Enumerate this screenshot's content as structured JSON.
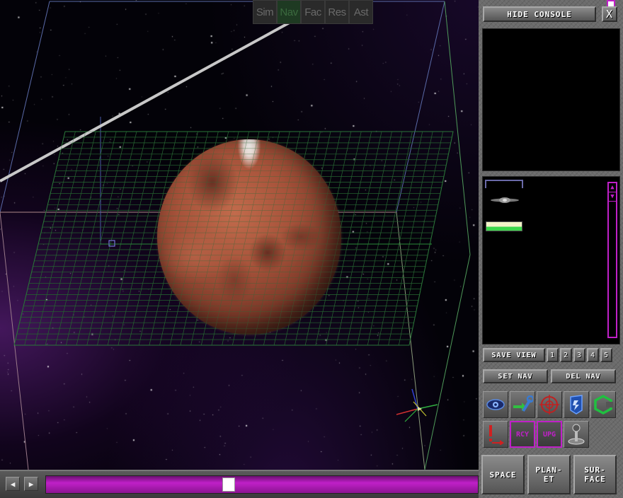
{
  "viewport": {
    "subtabs": [
      {
        "label": "Sim",
        "active": false
      },
      {
        "label": "Nav",
        "active": true
      },
      {
        "label": "Fac",
        "active": false
      },
      {
        "label": "Res",
        "active": false
      },
      {
        "label": "Ast",
        "active": false
      }
    ],
    "planet_icon": "mars-planet"
  },
  "timeline": {
    "left_arrow": "◀",
    "right_arrow": "▶",
    "position": 0.42
  },
  "console": {
    "hide_label": "HIDE CONSOLE",
    "close_label": "X",
    "list": {
      "scroll_up": "▲",
      "scroll_down": "▼",
      "ship_icon": "ship-icon",
      "health_fill": 0.45
    },
    "save_view_label": "SAVE VIEW",
    "view_slots": [
      "1",
      "2",
      "3",
      "4",
      "5"
    ],
    "set_nav_label": "SET NAV",
    "del_nav_label": "DEL NAV",
    "tools": [
      {
        "name": "eye-icon"
      },
      {
        "name": "wrench-arrow-icon"
      },
      {
        "name": "crosshair-icon"
      },
      {
        "name": "shield-icon"
      },
      {
        "name": "hexagon-icon"
      },
      {
        "name": "alert-arrow-icon"
      },
      {
        "label": "RCY"
      },
      {
        "label": "UPG"
      },
      {
        "name": "joystick-icon"
      }
    ],
    "space_label": "SPACE",
    "planet_label": "PLAN-\nET",
    "surface_label": "SUR-\nFACE"
  },
  "colors": {
    "accent": "#c020c8",
    "panel": "#6b6b6b",
    "active_tab": "#1e3a22"
  }
}
